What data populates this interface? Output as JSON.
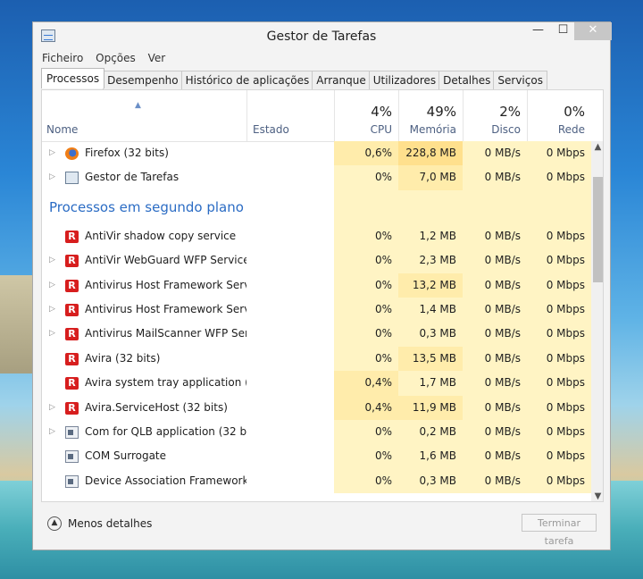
{
  "window": {
    "title": "Gestor de Tarefas",
    "controls": {
      "minimize": "—",
      "maximize": "☐",
      "close": "✕"
    }
  },
  "menu": [
    "Ficheiro",
    "Opções",
    "Ver"
  ],
  "tabs": [
    "Processos",
    "Desempenho",
    "Histórico de aplicações",
    "Arranque",
    "Utilizadores",
    "Detalhes",
    "Serviços"
  ],
  "columns": {
    "name": "Nome",
    "state": "Estado",
    "cpu": {
      "label": "CPU",
      "pct": "4%"
    },
    "memory": {
      "label": "Memória",
      "pct": "49%"
    },
    "disk": {
      "label": "Disco",
      "pct": "2%"
    },
    "network": {
      "label": "Rede",
      "pct": "0%"
    }
  },
  "apps": [
    {
      "name": "Firefox (32 bits)",
      "icon": "firefox-icon",
      "expandable": true,
      "cpu": "0,6%",
      "mem": "228,8 MB",
      "disk": "0 MB/s",
      "net": "0 Mbps"
    },
    {
      "name": "Gestor de Tarefas",
      "icon": "task-manager-icon",
      "expandable": true,
      "cpu": "0%",
      "mem": "7,0 MB",
      "disk": "0 MB/s",
      "net": "0 Mbps"
    }
  ],
  "group_label": "Processos em segundo plano (...",
  "background": [
    {
      "name": "AntiVir shadow copy service",
      "icon": "avira-icon",
      "expandable": false,
      "cpu": "0%",
      "mem": "1,2 MB",
      "disk": "0 MB/s",
      "net": "0 Mbps"
    },
    {
      "name": "AntiVir WebGuard WFP Service (...",
      "icon": "avira-icon",
      "expandable": true,
      "cpu": "0%",
      "mem": "2,3 MB",
      "disk": "0 MB/s",
      "net": "0 Mbps"
    },
    {
      "name": "Antivirus Host Framework Servi...",
      "icon": "avira-icon",
      "expandable": true,
      "cpu": "0%",
      "mem": "13,2 MB",
      "disk": "0 MB/s",
      "net": "0 Mbps"
    },
    {
      "name": "Antivirus Host Framework Servi...",
      "icon": "avira-icon",
      "expandable": true,
      "cpu": "0%",
      "mem": "1,4 MB",
      "disk": "0 MB/s",
      "net": "0 Mbps"
    },
    {
      "name": "Antivirus MailScanner WFP Serv...",
      "icon": "avira-icon",
      "expandable": true,
      "cpu": "0%",
      "mem": "0,3 MB",
      "disk": "0 MB/s",
      "net": "0 Mbps"
    },
    {
      "name": "Avira (32 bits)",
      "icon": "avira-icon",
      "expandable": false,
      "cpu": "0%",
      "mem": "13,5 MB",
      "disk": "0 MB/s",
      "net": "0 Mbps"
    },
    {
      "name": "Avira system tray application (3...",
      "icon": "avira-icon",
      "expandable": false,
      "cpu": "0,4%",
      "mem": "1,7 MB",
      "disk": "0 MB/s",
      "net": "0 Mbps"
    },
    {
      "name": "Avira.ServiceHost (32 bits)",
      "icon": "avira-icon",
      "expandable": true,
      "cpu": "0,4%",
      "mem": "11,9 MB",
      "disk": "0 MB/s",
      "net": "0 Mbps"
    },
    {
      "name": "Com for QLB application (32 bits)",
      "icon": "app-icon",
      "expandable": true,
      "cpu": "0%",
      "mem": "0,2 MB",
      "disk": "0 MB/s",
      "net": "0 Mbps"
    },
    {
      "name": "COM Surrogate",
      "icon": "app-icon",
      "expandable": false,
      "cpu": "0%",
      "mem": "1,6 MB",
      "disk": "0 MB/s",
      "net": "0 Mbps"
    },
    {
      "name": "Device Association Framework ...",
      "icon": "app-icon",
      "expandable": false,
      "cpu": "0%",
      "mem": "0,3 MB",
      "disk": "0 MB/s",
      "net": "0 Mbps"
    }
  ],
  "footer": {
    "less_details": "Menos detalhes",
    "end_task": "Terminar tarefa"
  }
}
